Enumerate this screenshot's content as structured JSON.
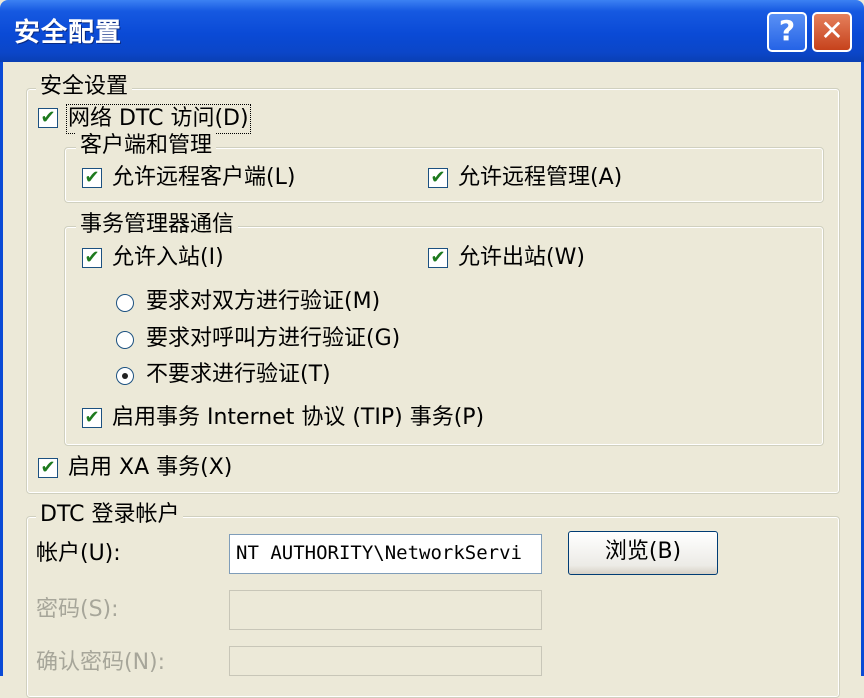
{
  "window": {
    "title": "安全配置",
    "help_glyph": "?",
    "close_glyph": "✕"
  },
  "security": {
    "legend": "安全设置",
    "network_dtc_label": "网络 DTC 访问(D)",
    "client_admin": {
      "legend": "客户端和管理",
      "allow_remote_clients": "允许远程客户端(L)",
      "allow_remote_admin": "允许远程管理(A)"
    },
    "tm_comm": {
      "legend": "事务管理器通信",
      "allow_inbound": "允许入站(I)",
      "allow_outbound": "允许出站(W)",
      "radio_mutual": "要求对双方进行验证(M)",
      "radio_caller": "要求对呼叫方进行验证(G)",
      "radio_none": "不要求进行验证(T)",
      "tip_label": "启用事务 Internet 协议 (TIP) 事务(P)"
    },
    "xa_label": "启用 XA 事务(X)"
  },
  "logon": {
    "legend": "DTC 登录帐户",
    "account_label": "帐户(U):",
    "account_value": "NT AUTHORITY\\NetworkServi",
    "browse_label": "浏览(B)",
    "password_label": "密码(S):",
    "confirm_label": "确认密码(N):"
  }
}
